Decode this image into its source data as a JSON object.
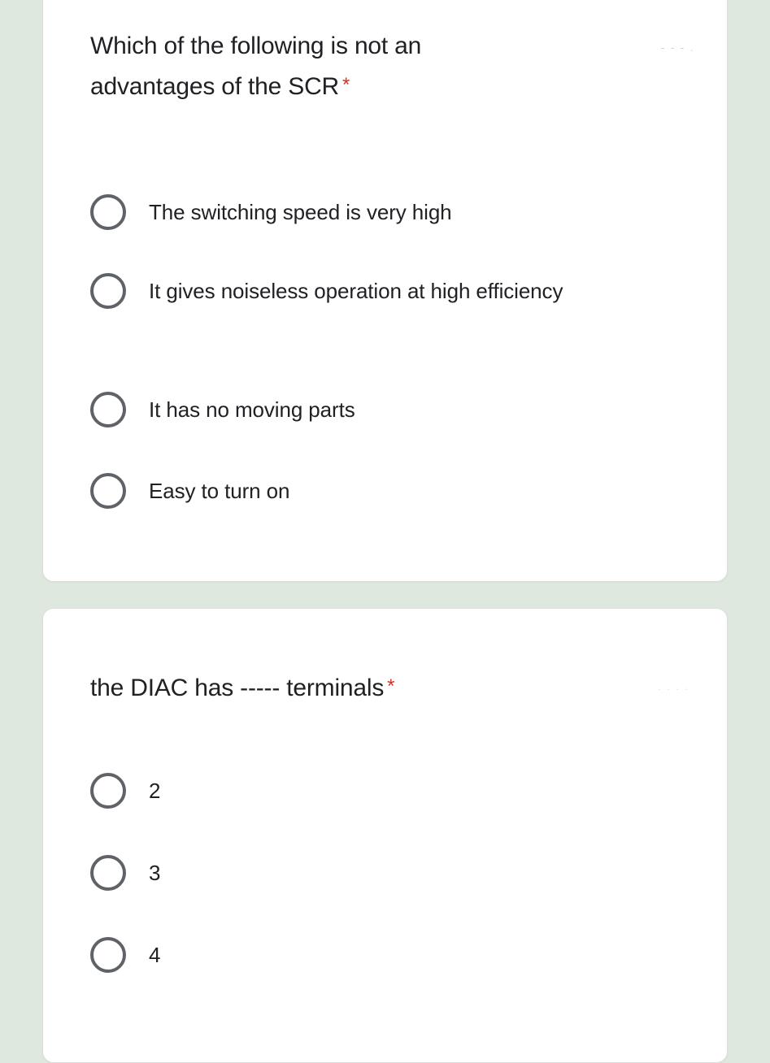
{
  "page": {
    "background_color": "#dfe8df",
    "card_background": "#ffffff",
    "required_marker_color": "#d93025",
    "radio_color": "#5f6368",
    "text_color": "#202124"
  },
  "questions": [
    {
      "id": "q1",
      "title": "Which of the following is not an advantages of the SCR",
      "required_marker": "*",
      "ghost_artifact": "- - - .",
      "options": [
        {
          "label": "The switching speed is very high",
          "selected": false
        },
        {
          "label": "It gives noiseless operation at high efficiency",
          "selected": false
        },
        {
          "label": "It has no moving parts",
          "selected": false
        },
        {
          "label": "Easy to turn on",
          "selected": false
        }
      ]
    },
    {
      "id": "q2",
      "title": "the DIAC has ----- terminals",
      "required_marker": "*",
      "ghost_artifact": ". . . .",
      "options": [
        {
          "label": "2",
          "selected": false
        },
        {
          "label": "3",
          "selected": false
        },
        {
          "label": "4",
          "selected": false
        }
      ]
    }
  ]
}
